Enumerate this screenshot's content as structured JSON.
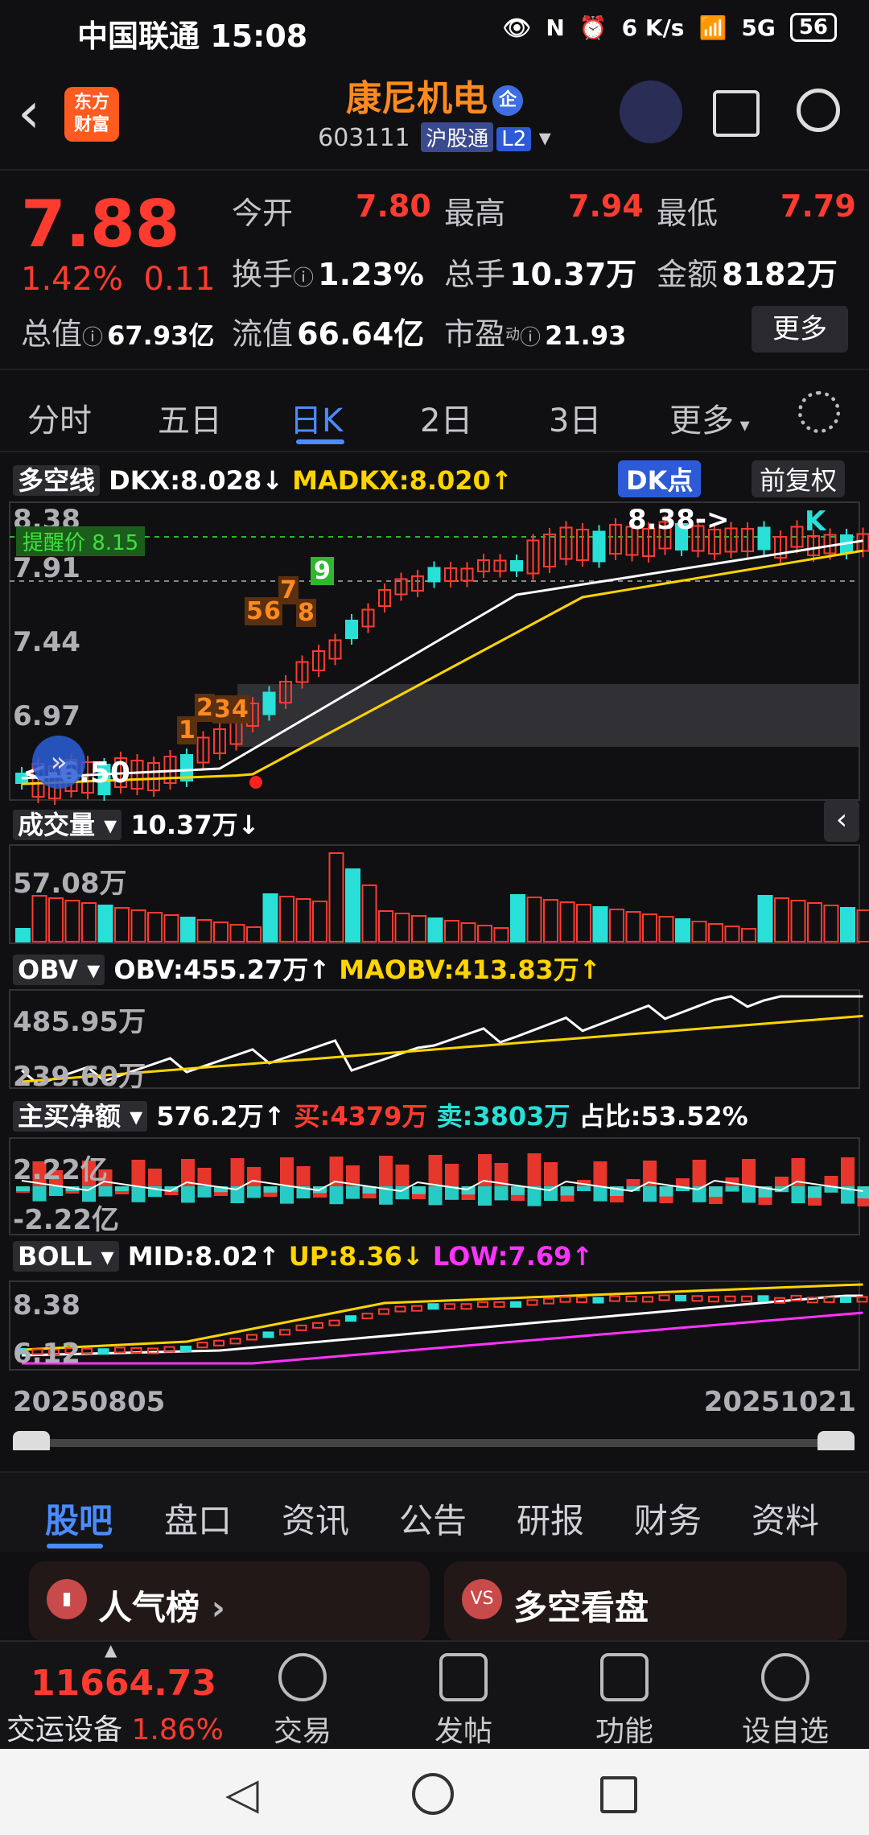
{
  "status": {
    "carrier": "中国联通",
    "time": "15:08",
    "net_speed_top": "6",
    "net_speed_unit": "K/s",
    "signal": "5G",
    "battery": "56"
  },
  "header": {
    "name": "康尼机电",
    "badge": "企",
    "code": "603111",
    "market_tag": "沪股通",
    "level_tag": "L2",
    "logo_line1": "东方",
    "logo_line2": "财富"
  },
  "quote": {
    "price": "7.88",
    "change_pct": "1.42%",
    "change_abs": "0.11",
    "open_label": "今开",
    "open": "7.80",
    "high_label": "最高",
    "high": "7.94",
    "low_label": "最低",
    "low": "7.79",
    "turnover_label": "换手",
    "turnover": "1.23%",
    "volume_label": "总手",
    "volume": "10.37万",
    "amount_label": "金额",
    "amount": "8182万",
    "mktcap_label": "总值",
    "mktcap": "67.93亿",
    "float_label": "流值",
    "float": "66.64亿",
    "pe_label": "市盈",
    "pe_sup": "动",
    "pe": "21.93",
    "more": "更多"
  },
  "period_tabs": [
    "分时",
    "五日",
    "日K",
    "2日",
    "3日",
    "更多"
  ],
  "chart": {
    "dkx_label": "多空线",
    "dkx": "DKX:8.028↓",
    "madkx": "MADKX:8.020↑",
    "dk_btn": "DK点",
    "fq_btn": "前复权",
    "price_axis": [
      "8.38",
      "7.91",
      "7.44",
      "6.97"
    ],
    "alert": "提醒价 8.15",
    "high_marker": "8.38->",
    "low_marker": "<-6.50",
    "k_marker": "K",
    "seq_numbers": [
      "1",
      "2",
      "3",
      "4",
      "5",
      "6",
      "7",
      "8",
      "9"
    ],
    "vol_label": "成交量",
    "vol_value": "10.37万↓",
    "vol_axis": "57.08万",
    "obv_label": "OBV",
    "obv": "OBV:455.27万↑",
    "maobv": "MAOBV:413.83万↑",
    "obv_axis_top": "485.95万",
    "obv_axis_bot": "239.60万",
    "net_label": "主买净额",
    "net": "576.2万↑",
    "buy": "买:4379万",
    "sell": "卖:3803万",
    "ratio": "占比:53.52%",
    "net_axis_top": "2.22亿",
    "net_axis_bot": "-2.22亿",
    "boll_label": "BOLL",
    "mid": "MID:8.02↑",
    "up": "UP:8.36↓",
    "low": "LOW:7.69↑",
    "boll_axis_top": "8.38",
    "boll_axis_bot": "6.12",
    "date_start": "20250805",
    "date_end": "20251021"
  },
  "section_tabs": [
    "股吧",
    "盘口",
    "资讯",
    "公告",
    "研报",
    "财务",
    "资料"
  ],
  "cards": {
    "left": "人气榜",
    "right": "多空看盘",
    "right_icon": "VS"
  },
  "bottom": {
    "index_value": "11664.73",
    "index_name": "交运设备",
    "index_change": "1.86%",
    "nav": [
      "交易",
      "发帖",
      "功能",
      "设自选"
    ]
  }
}
